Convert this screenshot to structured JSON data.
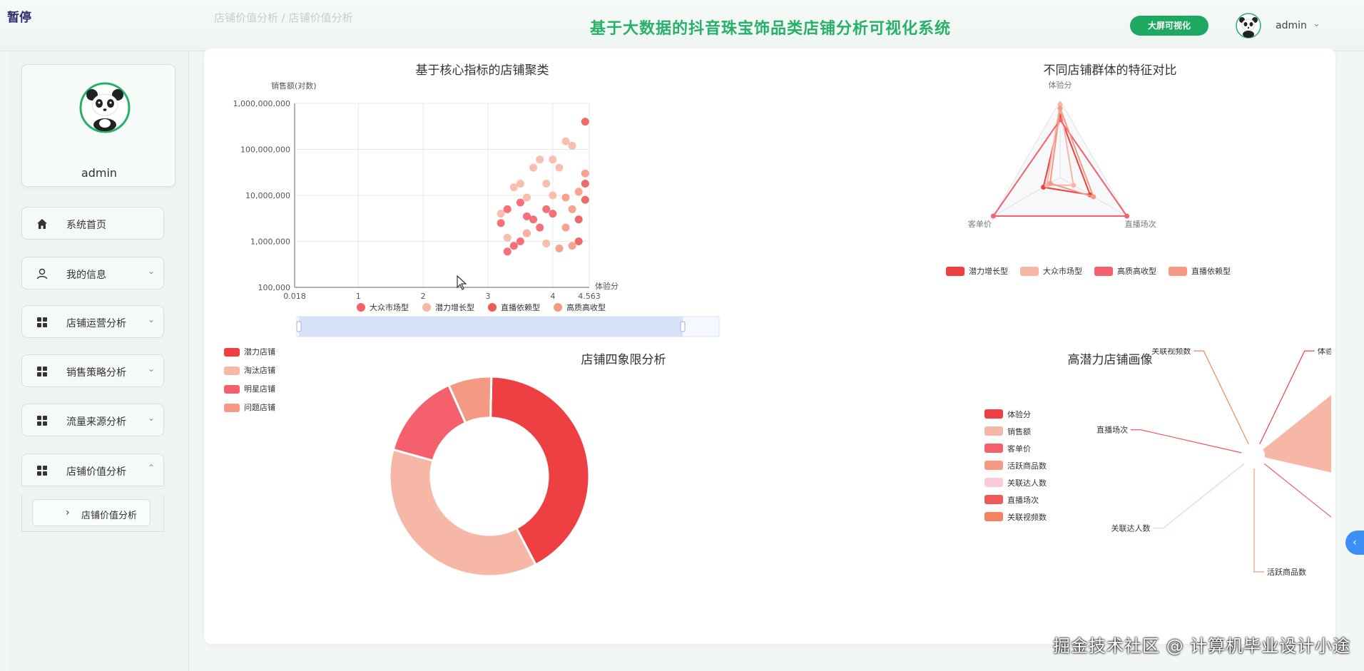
{
  "header": {
    "pause_tag": "暂停",
    "breadcrumb": "店铺价值分析 / 店铺价值分析",
    "title": "基于大数据的抖音珠宝饰品类店铺分析可视化系统",
    "bigscreen_button": "大屏可视化",
    "user_name": "admin",
    "caret": "⌄"
  },
  "sidebar": {
    "profile_name": "admin",
    "items": [
      {
        "label": "系统首页",
        "icon": "home-icon",
        "caret": ""
      },
      {
        "label": "我的信息",
        "icon": "user-icon",
        "caret": "⌄"
      },
      {
        "label": "店铺运营分析",
        "icon": "grid-icon",
        "caret": "⌄"
      },
      {
        "label": "销售策略分析",
        "icon": "grid-icon",
        "caret": "⌄"
      },
      {
        "label": "流量来源分析",
        "icon": "grid-icon",
        "caret": "⌄"
      },
      {
        "label": "店铺价值分析",
        "icon": "grid-icon",
        "caret": "⌃"
      }
    ],
    "submenu": {
      "label": "店铺价值分析",
      "arrow": "›"
    }
  },
  "colors": {
    "accent": "#27b06a",
    "c1": "#ee3f42",
    "c2": "#f7b7a6",
    "c3": "#f4606c",
    "c4": "#f59a82",
    "c5": "#f8cbd6",
    "c6": "#ec5a5a",
    "c7": "#f48361"
  },
  "chart_data": [
    {
      "type": "scatter",
      "title": "基于核心指标的店铺聚类",
      "xlabel": "体验分",
      "ylabel": "销售额(对数)",
      "y_scale": "log",
      "xlim": [
        0.018,
        4.563
      ],
      "ylim": [
        100000,
        1000000000
      ],
      "x_ticks": [
        "0.018",
        "1",
        "2",
        "3",
        "4",
        "4.563"
      ],
      "y_ticks": [
        "1,000,000,000",
        "100,000,000",
        "10,000,000",
        "1,000,000",
        "100,000"
      ],
      "legend": [
        "大众市场型",
        "潜力增长型",
        "直播依赖型",
        "高质高收型"
      ],
      "legend_position": "bottom",
      "grid": true,
      "series": [
        {
          "name": "大众市场型",
          "points": [
            [
              3.3,
              600000
            ],
            [
              3.4,
              800000
            ],
            [
              3.5,
              1000000
            ],
            [
              3.6,
              1500000
            ],
            [
              3.7,
              3000000
            ],
            [
              3.8,
              2000000
            ],
            [
              3.9,
              5000000
            ],
            [
              4.0,
              4000000
            ],
            [
              3.2,
              2500000
            ],
            [
              3.3,
              5000000
            ],
            [
              3.5,
              7000000
            ],
            [
              3.6,
              3500000
            ]
          ]
        },
        {
          "name": "潜力增长型",
          "points": [
            [
              3.2,
              4000000
            ],
            [
              3.4,
              15000000
            ],
            [
              3.5,
              18000000
            ],
            [
              3.7,
              40000000
            ],
            [
              3.8,
              60000000
            ],
            [
              4.0,
              60000000
            ],
            [
              4.1,
              40000000
            ],
            [
              4.2,
              150000000
            ],
            [
              4.3,
              120000000
            ],
            [
              3.6,
              9000000
            ],
            [
              3.9,
              18000000
            ],
            [
              4.0,
              10000000
            ],
            [
              3.3,
              1200000
            ],
            [
              3.6,
              1500000
            ],
            [
              3.9,
              900000
            ]
          ]
        },
        {
          "name": "直播依赖型",
          "points": [
            [
              4.4,
              1000000
            ],
            [
              4.4,
              3000000
            ],
            [
              4.5,
              8000000
            ],
            [
              4.5,
              18000000
            ],
            [
              4.6,
              4000000
            ],
            [
              4.6,
              30000000
            ],
            [
              4.7,
              6000000
            ],
            [
              4.7,
              60000000
            ],
            [
              4.8,
              10000000
            ],
            [
              4.8,
              90000000
            ],
            [
              4.9,
              400000000
            ],
            [
              4.9,
              2000000
            ],
            [
              4.5,
              400000000
            ]
          ]
        },
        {
          "name": "高质高收型",
          "points": [
            [
              4.1,
              700000
            ],
            [
              4.2,
              2000000
            ],
            [
              4.3,
              5000000
            ],
            [
              4.4,
              12000000
            ],
            [
              4.5,
              30000000
            ],
            [
              4.6,
              40000000
            ],
            [
              4.7,
              1500000
            ],
            [
              4.8,
              3000000
            ],
            [
              4.9,
              20000000
            ],
            [
              4.3,
              800000
            ],
            [
              4.2,
              9000000
            ],
            [
              4.6,
              700000
            ]
          ]
        }
      ]
    },
    {
      "type": "radar",
      "title": "不同店铺群体的特征对比",
      "indicators": [
        "体验分",
        "直播场次",
        "客单价"
      ],
      "legend": [
        "潜力增长型",
        "大众市场型",
        "高质高收型",
        "直播依赖型"
      ],
      "legend_position": "bottom",
      "series": [
        {
          "name": "潜力增长型",
          "values": [
            0.8,
            0.45,
            0.25
          ]
        },
        {
          "name": "大众市场型",
          "values": [
            0.95,
            0.2,
            0.2
          ]
        },
        {
          "name": "高质高收型",
          "values": [
            0.75,
            1.0,
            1.0
          ]
        },
        {
          "name": "直播依赖型",
          "values": [
            0.9,
            0.5,
            0.15
          ]
        }
      ]
    },
    {
      "type": "pie",
      "title": "店铺四象限分析",
      "legend": [
        "潜力店铺",
        "淘汰店铺",
        "明星店铺",
        "问题店铺"
      ],
      "legend_position": "top-left",
      "donut": true,
      "values": [
        42,
        37,
        14,
        7
      ]
    },
    {
      "type": "pie",
      "title": "高潜力店铺画像",
      "rose": true,
      "legend": [
        "体验分",
        "销售额",
        "客单价",
        "活跃商品数",
        "关联达人数",
        "直播场次",
        "关联视频数"
      ],
      "legend_position": "left",
      "categories": [
        "体验分",
        "销售额",
        "客单价",
        "活跃商品数",
        "关联达人数",
        "直播场次",
        "关联视频数"
      ],
      "values": [
        0.5,
        100,
        0.5,
        0.5,
        0.5,
        0.5,
        0.5
      ]
    }
  ],
  "watermark": "掘金技术社区 @ 计算机毕业设计小途",
  "side_tab_glyph": "‹"
}
